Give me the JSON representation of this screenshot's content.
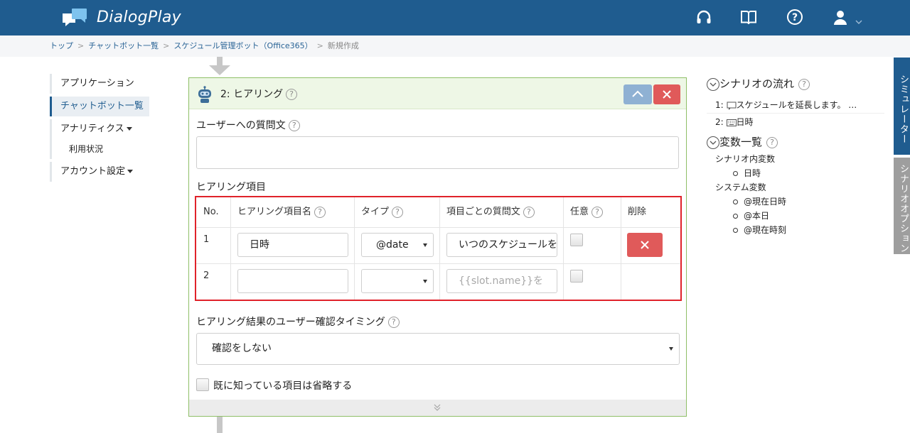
{
  "app": {
    "name": "DialogPlay"
  },
  "header": {
    "icons": [
      "headset-icon",
      "book-icon",
      "help-circle-icon",
      "user-icon",
      "chevron-down-icon"
    ]
  },
  "breadcrumb": {
    "items": [
      "トップ",
      "チャットボット一覧",
      "スケジュール管理ボット（Office365）"
    ],
    "current": "新規作成",
    "separator": ">"
  },
  "sidebar": {
    "items": [
      {
        "label": "アプリケーション"
      },
      {
        "label": "チャットボット一覧"
      },
      {
        "label": "アナリティクス"
      },
      {
        "label": "利用状況"
      },
      {
        "label": "アカウント設定"
      }
    ]
  },
  "card": {
    "title": "2: ヒアリング",
    "question_label": "ユーザーへの質問文",
    "question_value": "",
    "items_label": "ヒアリング項目",
    "table": {
      "headers": [
        "No.",
        "ヒアリング項目名",
        "タイプ",
        "項目ごとの質問文",
        "任意",
        "削除"
      ],
      "rows": [
        {
          "no": "1",
          "name": "日時",
          "type": "@date",
          "question": "いつのスケジュールを",
          "question_placeholder": "",
          "optional": false
        },
        {
          "no": "2",
          "name": "",
          "type": "",
          "question": "",
          "question_placeholder": "{{slot.name}}を",
          "optional": false
        }
      ]
    },
    "confirm_label": "ヒアリング結果のユーザー確認タイミング",
    "confirm_value": "確認をしない",
    "skip_label": "既に知っている項目は省略する",
    "skip_checked": false
  },
  "right": {
    "flow_title": "シナリオの流れ",
    "flow_items": [
      {
        "index": "1:",
        "text": "スケジュールを延長します。 …"
      },
      {
        "index": "2:",
        "text": "日時"
      }
    ],
    "vars_title": "変数一覧",
    "scenario_vars_label": "シナリオ内変数",
    "scenario_vars": [
      "日時"
    ],
    "system_vars_label": "システム変数",
    "system_vars": [
      "@現在日時",
      "@本日",
      "@現在時刻"
    ]
  },
  "side_tabs": [
    "シミュレーター",
    "シナリオオプション"
  ],
  "colors": {
    "header": "#1f5c8f",
    "card_border": "#8fbf67",
    "danger": "#e05a5a",
    "highlight": "#e0222a"
  }
}
